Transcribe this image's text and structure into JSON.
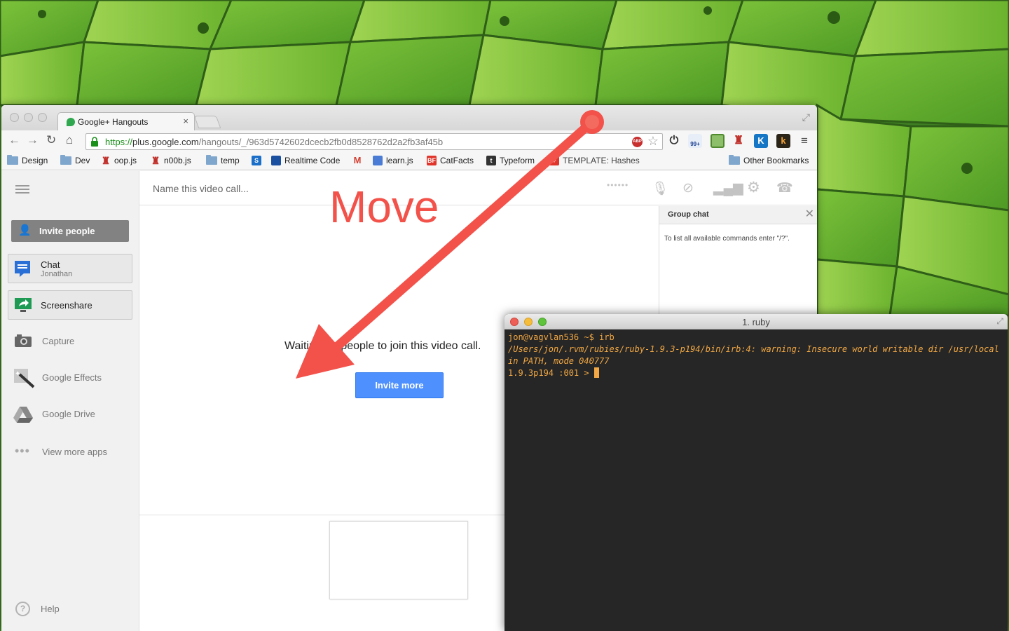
{
  "browser": {
    "tab_title": "Google+ Hangouts",
    "tab_close": "×",
    "url_scheme": "https://",
    "url_host": "plus.google.com",
    "url_path": "/hangouts/_/963d5742602dcecb2fb0d8528762d2a2fb3af45b",
    "nav": {
      "back": "←",
      "forward": "→",
      "reload": "↻",
      "home": "⌂"
    },
    "extensions": {
      "abp": "ABP",
      "badge_count": "99+",
      "k_blue": "K",
      "k_dark": "k"
    },
    "bookmarks": [
      {
        "label": "Design"
      },
      {
        "label": "Dev"
      },
      {
        "label": "oop.js"
      },
      {
        "label": "n00b.js"
      },
      {
        "label": "temp"
      },
      {
        "label": "Realtime Code"
      },
      {
        "label": ""
      },
      {
        "label": "learn.js"
      },
      {
        "label": "CatFacts"
      },
      {
        "label": "Typeform"
      },
      {
        "label": "TEMPLATE: Hashes"
      }
    ],
    "other_bookmarks": "Other Bookmarks"
  },
  "hangout": {
    "call_name_placeholder": "Name this video call...",
    "invite_people": "Invite people",
    "apps": [
      {
        "label": "Chat",
        "sub": "Jonathan"
      },
      {
        "label": "Screenshare"
      },
      {
        "label": "Capture"
      },
      {
        "label": "Google Effects"
      },
      {
        "label": "Google Drive"
      },
      {
        "label": "View more apps"
      }
    ],
    "help": "Help",
    "waiting_text": "Waiting for people to join this video call.",
    "invite_more": "Invite more",
    "group_chat": {
      "title": "Group chat",
      "hint": "To list all available commands enter \"/?\"."
    }
  },
  "terminal": {
    "title": "1. ruby",
    "lines": [
      "jon@vagvlan536 ~$ irb",
      "/Users/jon/.rvm/rubies/ruby-1.9.3-p194/bin/irb:4: warning: Insecure world writable dir /usr/local in PATH, mode 040777",
      "1.9.3p194 :001 > "
    ]
  },
  "annotation": {
    "label": "Move",
    "color": "#f2524a"
  }
}
